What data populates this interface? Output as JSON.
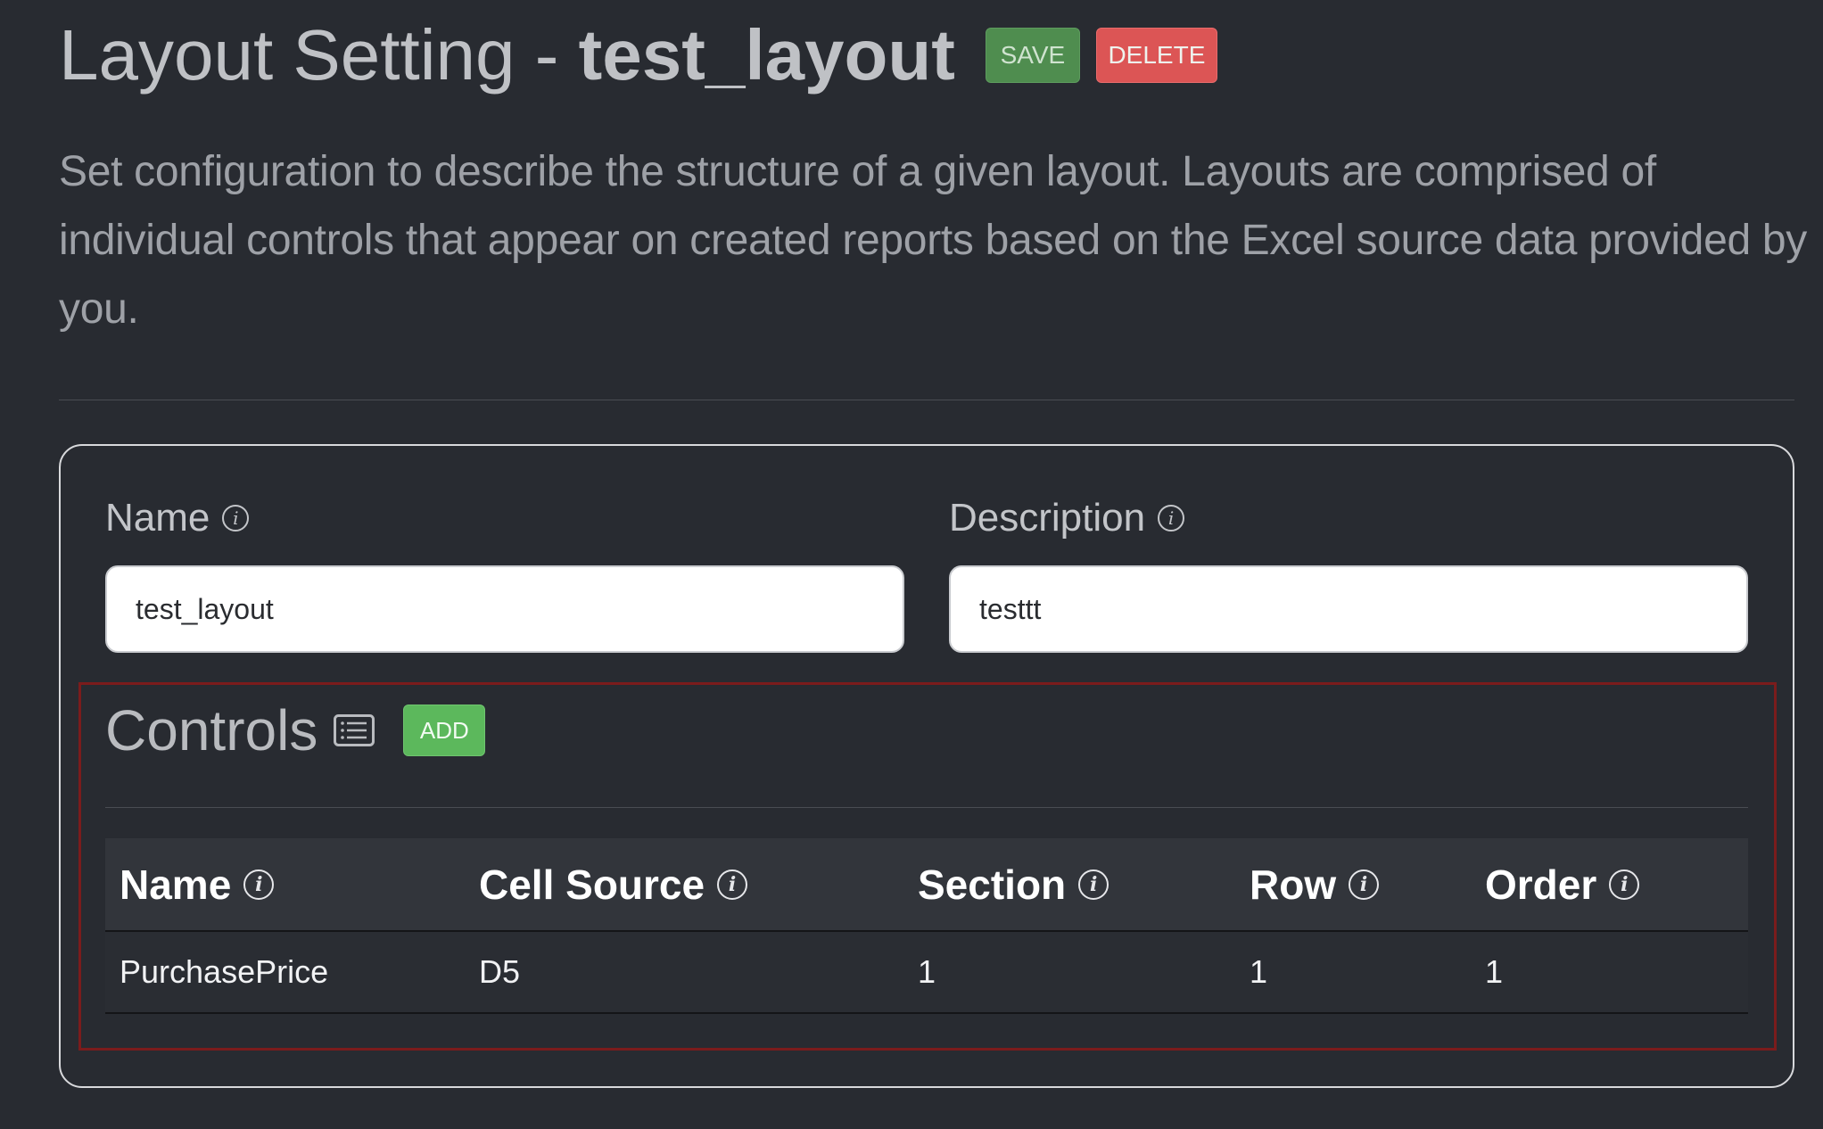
{
  "header": {
    "title_prefix": "Layout Setting - ",
    "title_name": "test_layout",
    "save_label": "SAVE",
    "delete_label": "DELETE"
  },
  "intro": {
    "text": "Set configuration to describe the structure of a given layout. Layouts are comprised of individual controls that appear on created reports based on the Excel source data provided by you."
  },
  "form": {
    "name_label": "Name",
    "name_value": "test_layout",
    "description_label": "Description",
    "description_value": "testtt"
  },
  "controls": {
    "title": "Controls",
    "add_label": "ADD",
    "columns": [
      "Name",
      "Cell Source",
      "Section",
      "Row",
      "Order"
    ],
    "rows": [
      {
        "name": "PurchasePrice",
        "cell_source": "D5",
        "section": "1",
        "row": "1",
        "order": "1"
      }
    ]
  },
  "icons": {
    "info": "info-icon",
    "list": "list-icon"
  },
  "colors": {
    "background": "#282b31",
    "save_button": "#4f8d4f",
    "delete_button": "#dc5555",
    "add_button": "#5cb85c",
    "highlight_border": "#7b1c1c"
  }
}
